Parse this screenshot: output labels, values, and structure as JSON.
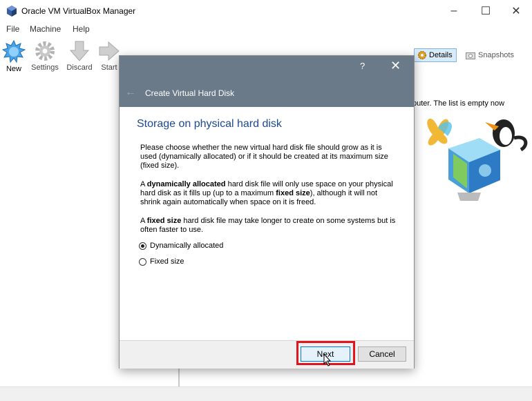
{
  "window": {
    "title": "Oracle VM VirtualBox Manager",
    "controls": [
      "–",
      "☐",
      "✕"
    ]
  },
  "menubar": [
    "File",
    "Machine",
    "Help"
  ],
  "toolbar": {
    "new": "New",
    "settings": "Settings",
    "discard": "Discard",
    "start": "Start"
  },
  "right_panel": {
    "details": "Details",
    "snapshots": "Snapshots",
    "welcome_fragment": "puter. The list is empty now"
  },
  "dialog": {
    "help": "?",
    "close": "✕",
    "title": "Create Virtual Hard Disk",
    "heading": "Storage on physical hard disk",
    "para1": "Please choose whether the new virtual hard disk file should grow as it is used (dynamically allocated) or if it should be created at its maximum size (fixed size).",
    "para2": {
      "a": "A ",
      "b": "dynamically allocated",
      "c": " hard disk file will only use space on your physical hard disk as it fills up (up to a maximum ",
      "d": "fixed size",
      "e": "), although it will not shrink again automatically when space on it is freed."
    },
    "para3": {
      "a": "A ",
      "b": "fixed size",
      "c": " hard disk file may take longer to create on some systems but is often faster to use."
    },
    "options": [
      {
        "label": "Dynamically allocated",
        "checked": true
      },
      {
        "label": "Fixed size",
        "checked": false
      }
    ],
    "buttons": {
      "next": "Next",
      "cancel": "Cancel"
    }
  },
  "colors": {
    "dialog_header": "#6b7a89",
    "heading": "#1c4a8d",
    "highlight": "#e0141e"
  }
}
